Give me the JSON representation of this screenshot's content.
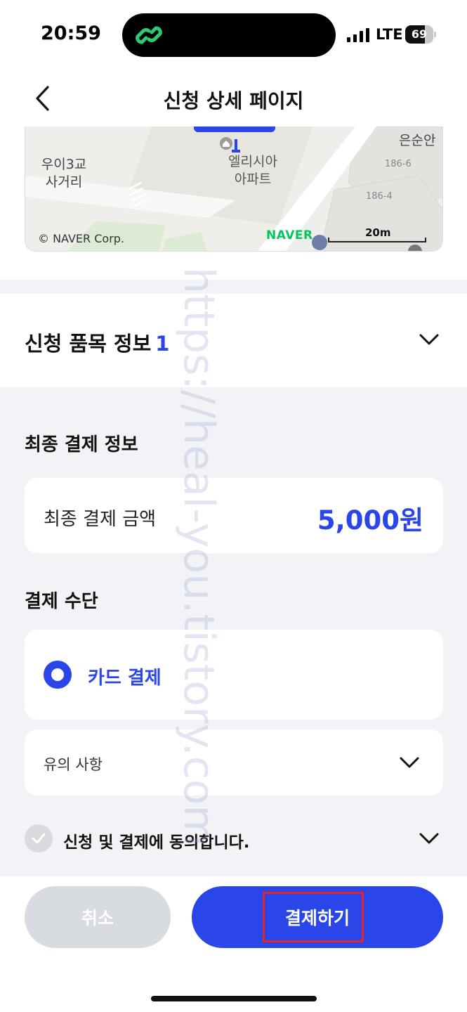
{
  "status_bar": {
    "time": "20:59",
    "network": "LTE",
    "battery": "69",
    "battery_level": 0.69
  },
  "header": {
    "title": "신청 상세 페이지"
  },
  "map": {
    "place_label": "엘리시아\n아파트",
    "intersection_label": "우이3교\n사거리",
    "poi_label": "은순안",
    "lot_1": "186-6",
    "lot_2": "186-4",
    "copyright": "© NAVER Corp.",
    "logo": "NAVER",
    "scale": "20m"
  },
  "item_section": {
    "title": "신청 품목 정보",
    "count": "1"
  },
  "payment_info": {
    "section_title": "최종 결제 정보",
    "amount_label": "최종 결제 금액",
    "amount_value": "5,000원"
  },
  "payment_method": {
    "section_title": "결제 수단",
    "selected_option": "카드 결제"
  },
  "notice": {
    "label": "유의 사항"
  },
  "agreement": {
    "label": "신청 및 결제에 동의합니다."
  },
  "buttons": {
    "cancel": "취소",
    "pay": "결제하기"
  },
  "watermark": "https://heal-you.tistory.com",
  "colors": {
    "accent": "#2a45e8",
    "background_gray": "#f2f3f6",
    "highlight": "#e3242b"
  }
}
